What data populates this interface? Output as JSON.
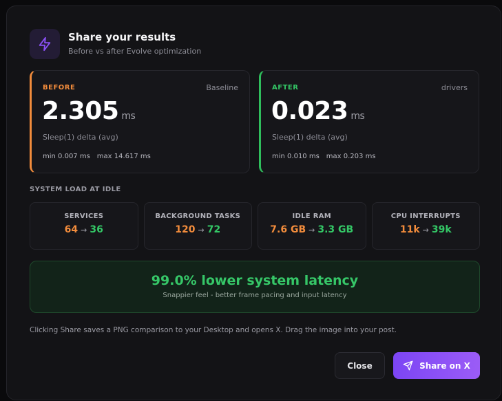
{
  "header": {
    "icon": "lightning-icon",
    "title": "Share your results",
    "subtitle": "Before vs after Evolve optimization"
  },
  "before": {
    "label": "BEFORE",
    "tag": "Baseline",
    "value": "2.305",
    "unit": "ms",
    "description": "Sleep(1) delta (avg)",
    "min": "min 0.007 ms",
    "max": "max 14.617 ms"
  },
  "after": {
    "label": "AFTER",
    "tag": "drivers",
    "value": "0.023",
    "unit": "ms",
    "description": "Sleep(1) delta (avg)",
    "min": "min 0.010 ms",
    "max": "max 0.203 ms"
  },
  "system_load": {
    "section_label": "SYSTEM LOAD AT IDLE",
    "stats": [
      {
        "label": "SERVICES",
        "before": "64",
        "after": "36"
      },
      {
        "label": "BACKGROUND TASKS",
        "before": "120",
        "after": "72"
      },
      {
        "label": "IDLE RAM",
        "before": "7.6 GB",
        "after": "3.3 GB"
      },
      {
        "label": "CPU INTERRUPTS",
        "before": "11k",
        "after": "39k"
      }
    ],
    "arrow": "→"
  },
  "improvement": {
    "title": "99.0% lower system latency",
    "subtitle": "Snappier feel - better frame pacing and input latency"
  },
  "note": "Clicking Share saves a PNG comparison to your Desktop and opens X. Drag the image into your post.",
  "buttons": {
    "close_label": "Close",
    "share_label": "Share on X",
    "share_icon": "send-icon"
  },
  "colors": {
    "accent": "#8b50f6",
    "before": "#f28c3c",
    "after": "#34c766"
  }
}
